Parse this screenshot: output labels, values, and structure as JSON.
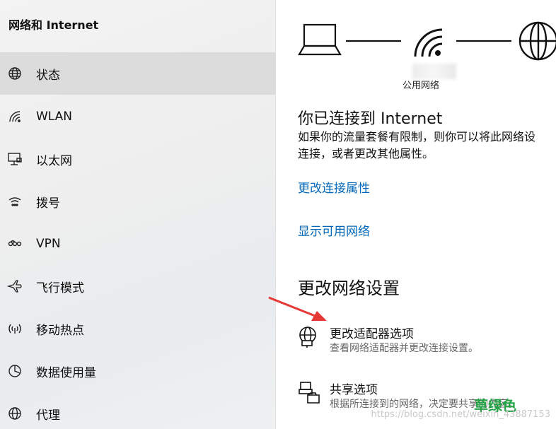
{
  "sidebar": {
    "title": "网络和 Internet",
    "items": [
      {
        "label": "状态",
        "icon": "globe-icon",
        "active": true
      },
      {
        "label": "WLAN",
        "icon": "wifi-icon"
      },
      {
        "label": "以太网",
        "icon": "ethernet-icon"
      },
      {
        "label": "拨号",
        "icon": "dialup-icon"
      },
      {
        "label": "VPN",
        "icon": "vpn-icon"
      },
      {
        "label": "飞行模式",
        "icon": "airplane-icon"
      },
      {
        "label": "移动热点",
        "icon": "hotspot-icon"
      },
      {
        "label": "数据使用量",
        "icon": "data-usage-icon"
      },
      {
        "label": "代理",
        "icon": "globe-icon"
      }
    ]
  },
  "main": {
    "network_label": "公用网络",
    "status_title": "你已连接到 Internet",
    "status_desc": "如果你的流量套餐有限制，则你可以将此网络设置为按流量计费的连接，或者更改其他属性。",
    "status_desc_line1": "如果你的流量套餐有限制，则你可以将此网络设",
    "status_desc_line2": "连接，或者更改其他属性。",
    "link_change_props": "更改连接属性",
    "link_show_networks": "显示可用网络",
    "section_title": "更改网络设置",
    "options": [
      {
        "title": "更改适配器选项",
        "desc": "查看网络适配器并更改连接设置。",
        "icon": "adapter-globe-icon"
      },
      {
        "title": "共享选项",
        "desc": "根据所连接到的网络，决定要共享的内容。",
        "icon": "sharing-icon"
      }
    ]
  },
  "watermark": {
    "url": "https://blog.csdn.net/weixin_43887153",
    "logo": "草绿色"
  },
  "colors": {
    "link": "#0067b8",
    "active_bg": "#dcdcdc",
    "arrow": "#e53935"
  }
}
